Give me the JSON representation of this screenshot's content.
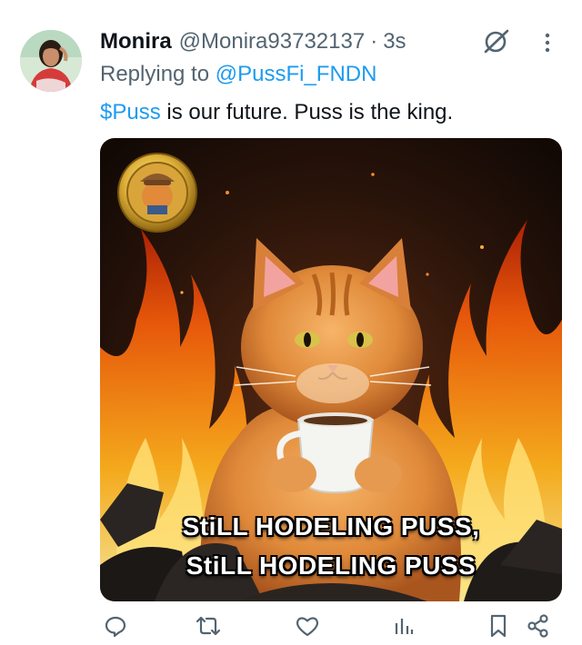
{
  "tweet": {
    "display_name": "Monira",
    "handle": "@Monira93732137",
    "separator": "·",
    "time": "3s",
    "replying_prefix": "Replying to",
    "replying_handle": "@PussFi_FNDN",
    "cashtag": "$Puss",
    "text_rest": " is our future. Puss is the king."
  },
  "media": {
    "caption_line1": "StiLL HODELING PUSS,",
    "caption_line2": "StiLL HODELING PUSS"
  },
  "icons": {
    "grok": "grok-icon",
    "more": "more-icon",
    "reply": "reply-icon",
    "retweet": "retweet-icon",
    "like": "like-icon",
    "views": "views-icon",
    "bookmark": "bookmark-icon",
    "share": "share-icon"
  },
  "colors": {
    "link": "#1d9bf0",
    "secondary_text": "#536471",
    "primary_text": "#0f1419"
  }
}
